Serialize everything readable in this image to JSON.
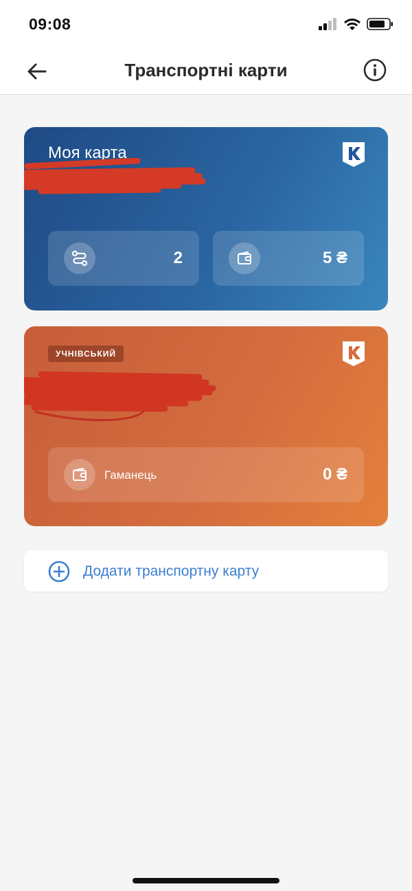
{
  "status_bar": {
    "time": "09:08",
    "icons": [
      "cellular-signal-icon",
      "wifi-icon",
      "battery-icon"
    ]
  },
  "header": {
    "title": "Транспортні карти",
    "back_icon": "arrow-left-icon",
    "info_icon": "info-icon"
  },
  "cards": [
    {
      "title": "Моя карта",
      "logo_icon": "k-shield-logo-icon",
      "color": "#2a64a0",
      "tiles": [
        {
          "icon": "route-icon",
          "value": "2"
        },
        {
          "icon": "wallet-icon",
          "value": "5 ₴"
        }
      ]
    },
    {
      "badge": "УЧНІВСЬКИЙ",
      "logo_icon": "k-shield-logo-icon",
      "color": "#d36c3e",
      "tiles": [
        {
          "icon": "wallet-icon",
          "label": "Гаманець",
          "value": "0 ₴"
        }
      ]
    }
  ],
  "add_card": {
    "icon": "plus-circle-icon",
    "label": "Додати транспортну карту",
    "color": "#3b7fd1"
  }
}
